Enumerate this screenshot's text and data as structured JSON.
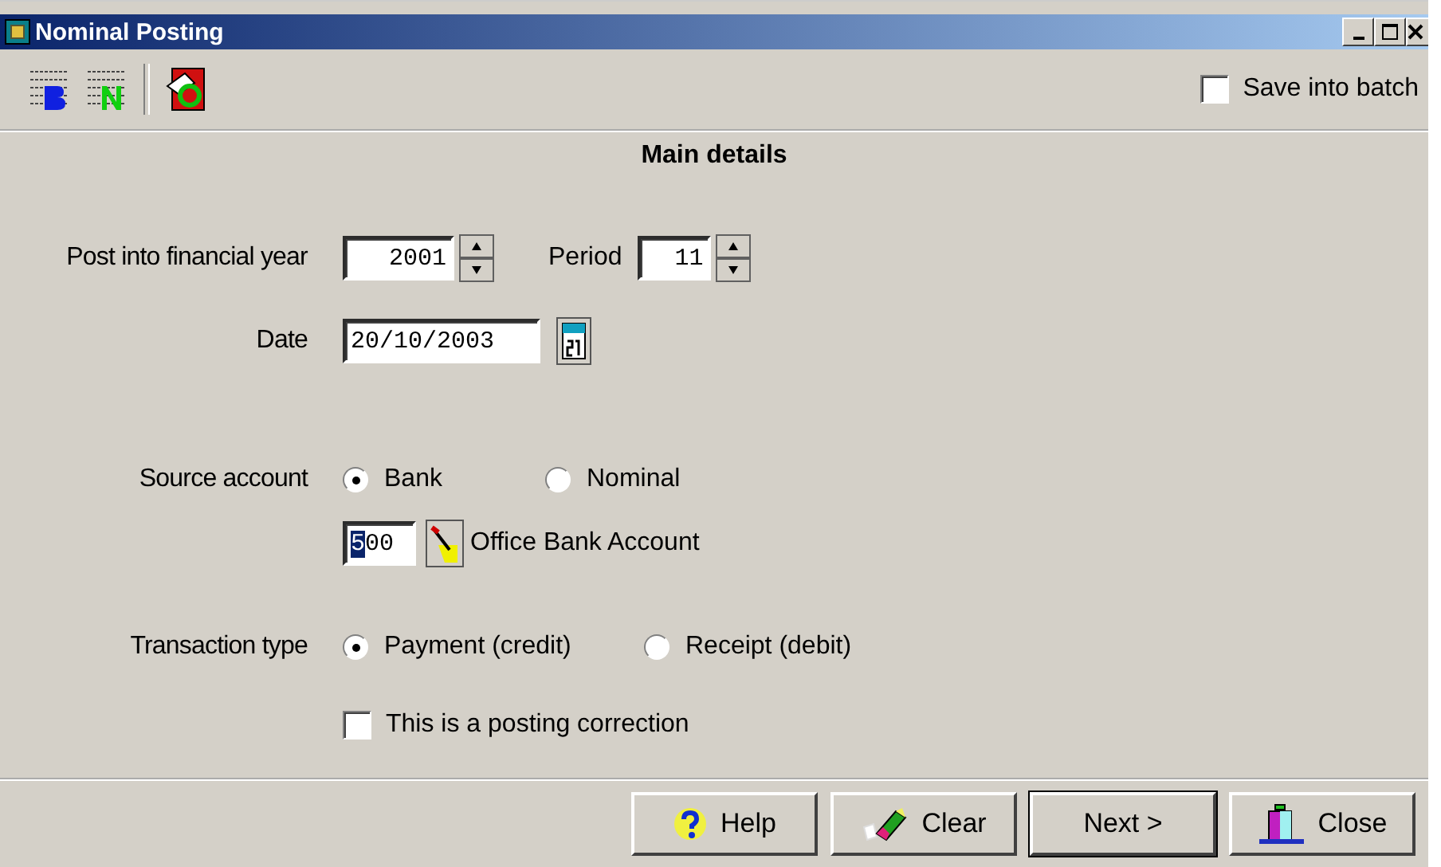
{
  "window": {
    "title": "Nominal Posting"
  },
  "toolbar": {
    "save_into_batch": {
      "label": "Save into batch",
      "checked": false
    }
  },
  "section_title": "Main details",
  "financial_year": {
    "label": "Post into financial year",
    "value": "2001"
  },
  "period": {
    "label": "Period",
    "value": "11"
  },
  "date": {
    "label": "Date",
    "value": "20/10/2003"
  },
  "source_account": {
    "label": "Source account",
    "options": [
      {
        "label": "Bank",
        "selected": true
      },
      {
        "label": "Nominal",
        "selected": false
      }
    ],
    "code": "500",
    "name": "Office Bank Account"
  },
  "transaction_type": {
    "label": "Transaction type",
    "options": [
      {
        "label": "Payment (credit)",
        "selected": true
      },
      {
        "label": "Receipt (debit)",
        "selected": false
      }
    ]
  },
  "posting_correction": {
    "label": "This is a posting correction",
    "checked": false
  },
  "buttons": [
    {
      "kind": "help",
      "label": "Help",
      "default": false
    },
    {
      "kind": "clear",
      "label": "Clear",
      "default": false
    },
    {
      "kind": "next",
      "label": "Next >",
      "default": true
    },
    {
      "kind": "close",
      "label": "Close",
      "default": false
    }
  ]
}
